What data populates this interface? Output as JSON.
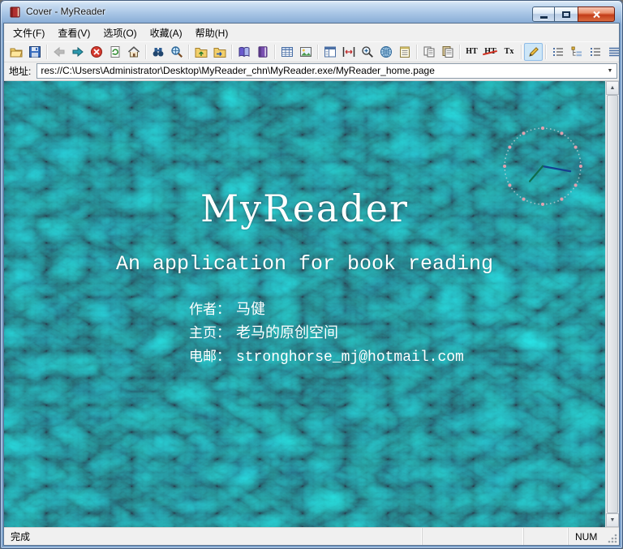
{
  "window": {
    "title": "Cover - MyReader"
  },
  "menu": {
    "items": [
      {
        "id": "file",
        "label": "文件(F)"
      },
      {
        "id": "view",
        "label": "查看(V)"
      },
      {
        "id": "options",
        "label": "选项(O)"
      },
      {
        "id": "favorites",
        "label": "收藏(A)"
      },
      {
        "id": "help",
        "label": "帮助(H)"
      }
    ]
  },
  "toolbar": {
    "buttons": [
      {
        "name": "open-button",
        "icon": "folder-open"
      },
      {
        "name": "save-button",
        "icon": "floppy"
      },
      {
        "type": "sep"
      },
      {
        "name": "back-button",
        "icon": "arrow-left",
        "disabled": true
      },
      {
        "name": "forward-button",
        "icon": "arrow-right"
      },
      {
        "name": "stop-button",
        "icon": "stop"
      },
      {
        "name": "refresh-button",
        "icon": "refresh"
      },
      {
        "name": "home-button",
        "icon": "home"
      },
      {
        "type": "sep"
      },
      {
        "name": "find-button",
        "icon": "binoculars"
      },
      {
        "name": "web-search-button",
        "icon": "search"
      },
      {
        "type": "sep"
      },
      {
        "name": "folder-up-button",
        "icon": "folder-up"
      },
      {
        "name": "folder-browse-button",
        "icon": "folder-go"
      },
      {
        "type": "sep"
      },
      {
        "name": "book-button",
        "icon": "book"
      },
      {
        "name": "book-edit-button",
        "icon": "book2"
      },
      {
        "type": "sep"
      },
      {
        "name": "table-view-button",
        "icon": "table"
      },
      {
        "name": "image-view-button",
        "icon": "image"
      },
      {
        "type": "sep"
      },
      {
        "name": "layout-button",
        "icon": "layout"
      },
      {
        "name": "fit-width-button",
        "icon": "fitwidth"
      },
      {
        "name": "zoom-button",
        "icon": "zoom"
      },
      {
        "name": "globe-button",
        "icon": "globe"
      },
      {
        "name": "notes-button",
        "icon": "notes"
      },
      {
        "type": "sep"
      },
      {
        "name": "copy-page-button",
        "icon": "pages"
      },
      {
        "name": "export-page-button",
        "icon": "pages2"
      },
      {
        "type": "sep"
      },
      {
        "name": "html-mode-button",
        "text": "HT"
      },
      {
        "name": "html-off-button",
        "text": "HT",
        "strike": true
      },
      {
        "name": "text-mode-button",
        "text": "Tx"
      },
      {
        "type": "sep"
      },
      {
        "name": "pen-button",
        "icon": "pen",
        "active": true
      },
      {
        "type": "sep"
      },
      {
        "name": "outline-button",
        "icon": "list"
      },
      {
        "name": "tree-view-button",
        "icon": "tree"
      },
      {
        "name": "detail-list-button",
        "icon": "list"
      },
      {
        "name": "grid-view-button",
        "icon": "grid"
      }
    ]
  },
  "address": {
    "label": "地址:",
    "value": "res://C:\\Users\\Administrator\\Desktop\\MyReader_chn\\MyReader.exe/MyReader_home.page"
  },
  "content": {
    "title": "MyReader",
    "subtitle": "An application for book reading",
    "info": [
      {
        "label": "作者：",
        "value": "马健"
      },
      {
        "label": "主页：",
        "value": "老马的原创空间"
      },
      {
        "label": "电邮：",
        "value": "stronghorse_mj@hotmail.com"
      }
    ]
  },
  "statusbar": {
    "status": "完成",
    "num": "NUM"
  },
  "icons": {
    "caret_down": "▼",
    "scroll_up": "▲",
    "scroll_down": "▼"
  },
  "colors": {
    "titlebar_top": "#cadef2",
    "titlebar_bottom": "#7fa3cd",
    "close_button": "#c23c19",
    "chrome_bg": "#f0f0f0",
    "water_base": "#06313c",
    "content_text": "#ffffff",
    "active_tool_highlight": "#cde6f7"
  }
}
